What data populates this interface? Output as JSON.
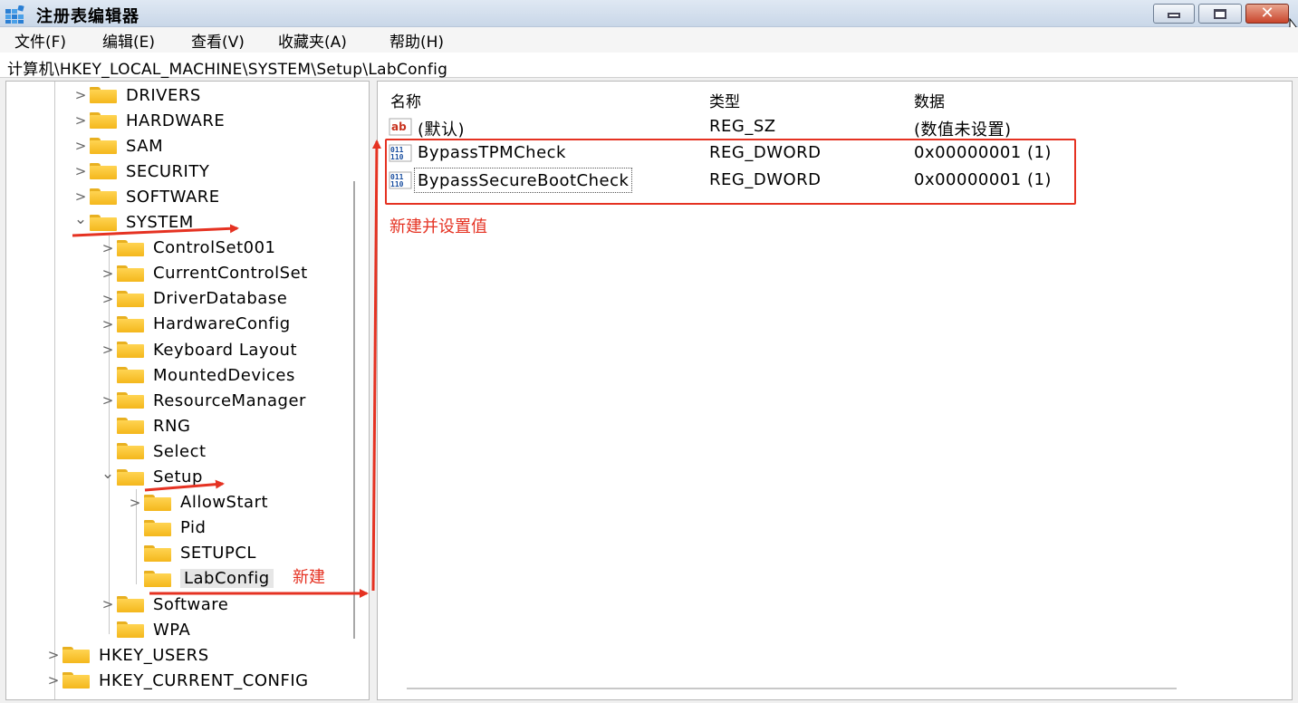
{
  "window": {
    "title": "注册表编辑器",
    "icon": "registry-editor-icon",
    "close_glyph": "✕"
  },
  "menu": [
    {
      "label": "文件(F)"
    },
    {
      "label": "编辑(E)"
    },
    {
      "label": "查看(V)"
    },
    {
      "label": "收藏夹(A)"
    },
    {
      "label": "帮助(H)"
    }
  ],
  "address": {
    "path": "计算机\\HKEY_LOCAL_MACHINE\\SYSTEM\\Setup\\LabConfig"
  },
  "tree": {
    "items": [
      {
        "label": "DRIVERS",
        "expander": ">"
      },
      {
        "label": "HARDWARE",
        "expander": ">"
      },
      {
        "label": "SAM",
        "expander": ">"
      },
      {
        "label": "SECURITY",
        "expander": ">"
      },
      {
        "label": "SOFTWARE",
        "expander": ">"
      },
      {
        "label": "SYSTEM",
        "expander": "⌄"
      },
      {
        "label": "ControlSet001",
        "expander": ">"
      },
      {
        "label": "CurrentControlSet",
        "expander": ">"
      },
      {
        "label": "DriverDatabase",
        "expander": ">"
      },
      {
        "label": "HardwareConfig",
        "expander": ">"
      },
      {
        "label": "Keyboard Layout",
        "expander": ">"
      },
      {
        "label": "MountedDevices",
        "expander": ""
      },
      {
        "label": "ResourceManager",
        "expander": ">"
      },
      {
        "label": "RNG",
        "expander": ""
      },
      {
        "label": "Select",
        "expander": ""
      },
      {
        "label": "Setup",
        "expander": "⌄"
      },
      {
        "label": "AllowStart",
        "expander": ">"
      },
      {
        "label": "Pid",
        "expander": ""
      },
      {
        "label": "SETUPCL",
        "expander": ""
      },
      {
        "label": "LabConfig",
        "expander": "",
        "selected": true
      },
      {
        "label": "Software",
        "expander": ">"
      },
      {
        "label": "WPA",
        "expander": ""
      },
      {
        "label": "HKEY_USERS",
        "expander": ">"
      },
      {
        "label": "HKEY_CURRENT_CONFIG",
        "expander": ">"
      }
    ]
  },
  "list": {
    "columns": {
      "name": "名称",
      "type": "类型",
      "data": "数据"
    },
    "rows": [
      {
        "icon": "string-value-icon",
        "name": "(默认)",
        "type": "REG_SZ",
        "data": "(数值未设置)"
      },
      {
        "icon": "dword-value-icon",
        "name": "BypassTPMCheck",
        "type": "REG_DWORD",
        "data": "0x00000001 (1)"
      },
      {
        "icon": "dword-value-icon",
        "name": "BypassSecureBootCheck",
        "type": "REG_DWORD",
        "data": "0x00000001 (1)"
      }
    ]
  },
  "annotations": {
    "new_key_note": "新建",
    "new_values_note": "新建并设置值",
    "color": "#e53222"
  },
  "icon_glyphs": {
    "string_icon_text": "ab",
    "dword_icon_text_top": "011",
    "dword_icon_text_bottom": "110"
  }
}
